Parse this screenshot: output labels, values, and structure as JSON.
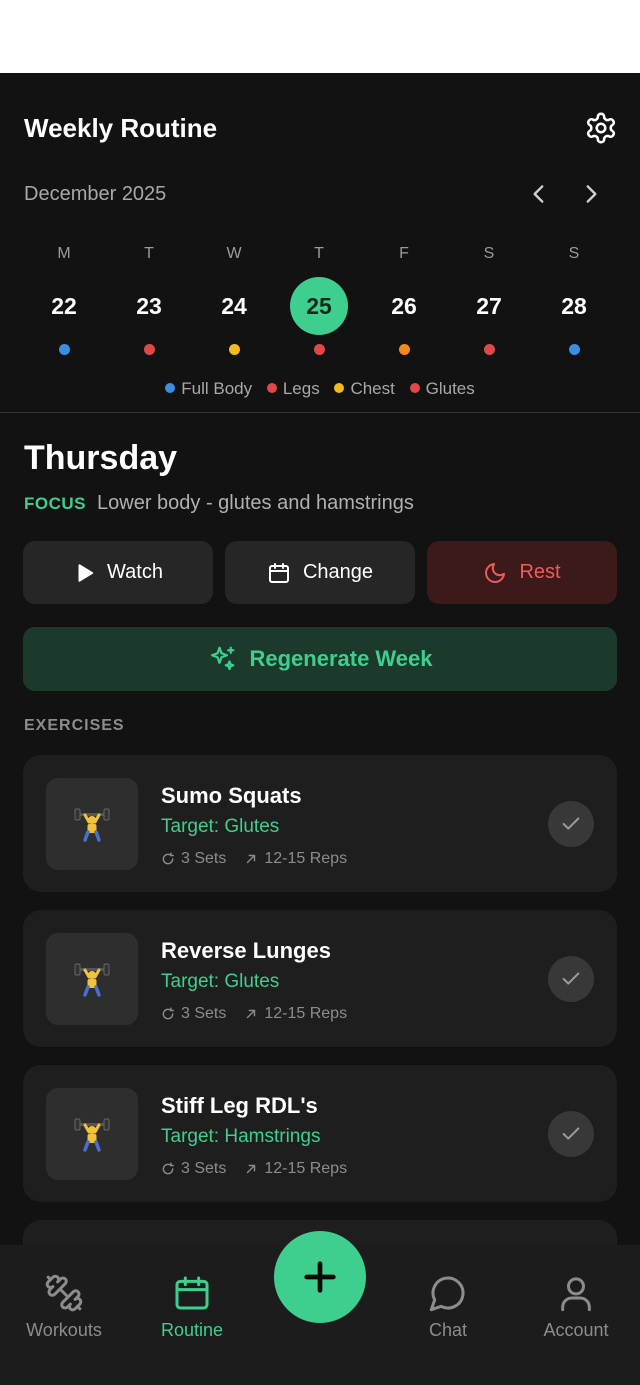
{
  "header": {
    "title": "Weekly Routine",
    "month": "December 2025"
  },
  "week": {
    "days": [
      {
        "letter": "M",
        "date": "22",
        "selected": false,
        "dot_color": "#3b8fe0"
      },
      {
        "letter": "T",
        "date": "23",
        "selected": false,
        "dot_color": "#e04848"
      },
      {
        "letter": "W",
        "date": "24",
        "selected": false,
        "dot_color": "#f2bb1f"
      },
      {
        "letter": "T",
        "date": "25",
        "selected": true,
        "dot_color": "#e04848"
      },
      {
        "letter": "F",
        "date": "26",
        "selected": false,
        "dot_color": "#f28a1f"
      },
      {
        "letter": "S",
        "date": "27",
        "selected": false,
        "dot_color": "#e04848"
      },
      {
        "letter": "S",
        "date": "28",
        "selected": false,
        "dot_color": "#3b8fe0"
      }
    ],
    "legend": [
      {
        "label": "Full Body",
        "color": "#3b8fe0"
      },
      {
        "label": "Legs",
        "color": "#e04848"
      },
      {
        "label": "Chest",
        "color": "#f2bb1f"
      },
      {
        "label": "Glutes",
        "color": "#e04848"
      }
    ]
  },
  "detail": {
    "day_title": "Thursday",
    "focus_label": "FOCUS",
    "focus_text": "Lower body - glutes and hamstrings",
    "actions": {
      "watch": "Watch",
      "change": "Change",
      "rest": "Rest"
    },
    "regenerate": "Regenerate Week"
  },
  "exercises": {
    "heading": "EXERCISES",
    "items": [
      {
        "name": "Sumo Squats",
        "target": "Target: Glutes",
        "sets": "3 Sets",
        "reps": "12-15 Reps"
      },
      {
        "name": "Reverse Lunges",
        "target": "Target: Glutes",
        "sets": "3 Sets",
        "reps": "12-15 Reps"
      },
      {
        "name": "Stiff Leg RDL's",
        "target": "Target: Hamstrings",
        "sets": "3 Sets",
        "reps": "12-15 Reps"
      }
    ]
  },
  "tabbar": {
    "workouts": "Workouts",
    "routine": "Routine",
    "chat": "Chat",
    "account": "Account"
  },
  "colors": {
    "accent": "#3ecf8e",
    "rest": "#ef5a5a",
    "background": "#121212"
  }
}
